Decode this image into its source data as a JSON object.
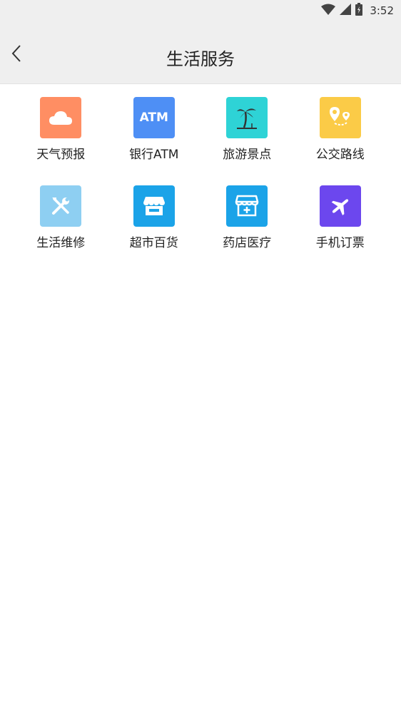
{
  "status_bar": {
    "time": "3:52"
  },
  "header": {
    "title": "生活服务",
    "back_icon": "chevron-left-icon"
  },
  "services": [
    {
      "label": "天气预报",
      "icon": "cloud-icon",
      "color": "#FF8E63"
    },
    {
      "label": "银行ATM",
      "icon": "atm-icon",
      "color": "#4E8FF5"
    },
    {
      "label": "旅游景点",
      "icon": "palm-tree-icon",
      "color": "#2ED3D6"
    },
    {
      "label": "公交路线",
      "icon": "route-pin-icon",
      "color": "#FBCB47"
    },
    {
      "label": "生活维修",
      "icon": "tools-icon",
      "color": "#8ECFF2"
    },
    {
      "label": "超市百货",
      "icon": "storefront-icon",
      "color": "#1BA3E8"
    },
    {
      "label": "药店医疗",
      "icon": "pharmacy-icon",
      "color": "#1BA3E8"
    },
    {
      "label": "手机订票",
      "icon": "airplane-icon",
      "color": "#6C47EE"
    }
  ],
  "atm_icon_text": "ATM"
}
